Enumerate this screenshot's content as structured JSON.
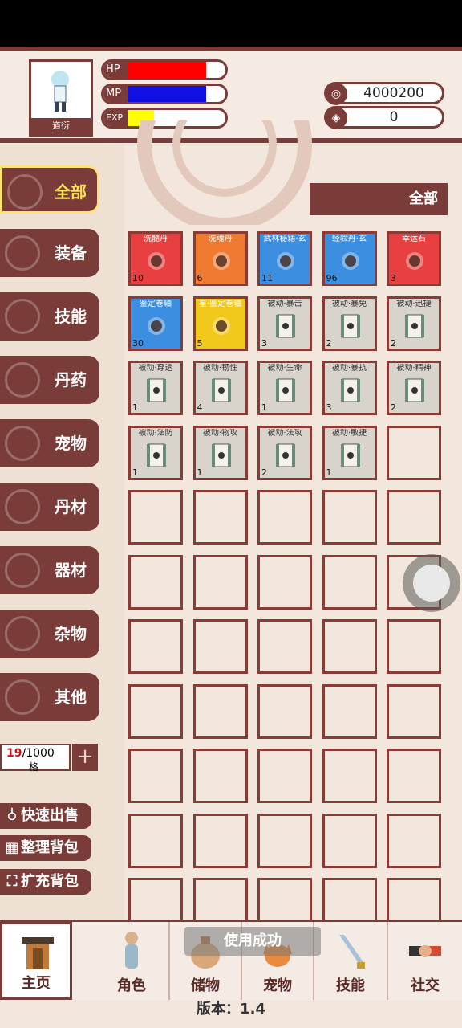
{
  "player": {
    "name": "道衍",
    "hp_label": "HP",
    "mp_label": "MP",
    "exp_label": "EXP",
    "hp_fill": 0.8,
    "mp_fill": 0.8,
    "exp_fill": 0.27,
    "gold": "4000200",
    "gems": "0"
  },
  "colors": {
    "brand": "#7a3c38",
    "hp": "#ff0000",
    "mp": "#1010e0",
    "exp": "#ffff00",
    "active": "#ffe15a"
  },
  "categories": [
    {
      "label": "全部",
      "active": true
    },
    {
      "label": "装备"
    },
    {
      "label": "技能"
    },
    {
      "label": "丹药"
    },
    {
      "label": "宠物"
    },
    {
      "label": "丹材"
    },
    {
      "label": "器材"
    },
    {
      "label": "杂物"
    },
    {
      "label": "其他"
    }
  ],
  "capacity": {
    "used": "19",
    "total": "/1000",
    "unit": "格"
  },
  "actions": {
    "quick_sell": "快速出售",
    "sort_bag": "整理背包",
    "expand_bag": "扩充背包"
  },
  "filter_tab": "全部",
  "items": [
    {
      "name": "洗髓丹",
      "count": "10",
      "bg": "#e84040",
      "icon": "red-orb-icon"
    },
    {
      "name": "洗魂丹",
      "count": "6",
      "bg": "#f07a30",
      "icon": "fire-orb-icon"
    },
    {
      "name": "武林秘籍·玄",
      "count": "11",
      "bg": "#3c8fe0",
      "icon": "scroll-book-icon"
    },
    {
      "name": "经验丹·玄",
      "count": "96",
      "bg": "#3c8fe0",
      "icon": "blue-pill-icon"
    },
    {
      "name": "幸运石",
      "count": "3",
      "bg": "#e84040",
      "icon": "green-gem-icon"
    },
    {
      "name": "鉴定卷轴",
      "count": "30",
      "bg": "#3c8fe0",
      "icon": "identify-scroll-icon"
    },
    {
      "name": "星·鉴定卷轴",
      "count": "5",
      "bg": "#f2c81c",
      "icon": "star-scroll-icon"
    },
    {
      "name": "被动·暴击",
      "count": "3",
      "bg": "#d8d4cc",
      "icon": "passive-scroll-icon"
    },
    {
      "name": "被动·暴免",
      "count": "2",
      "bg": "#d8d4cc",
      "icon": "passive-scroll-icon"
    },
    {
      "name": "被动·迅捷",
      "count": "2",
      "bg": "#d8d4cc",
      "icon": "passive-scroll-icon"
    },
    {
      "name": "被动·穿透",
      "count": "1",
      "bg": "#d8d4cc",
      "icon": "passive-scroll-icon"
    },
    {
      "name": "被动·韧性",
      "count": "4",
      "bg": "#d8d4cc",
      "icon": "passive-scroll-icon"
    },
    {
      "name": "被动·生命",
      "count": "1",
      "bg": "#d8d4cc",
      "icon": "passive-scroll-icon"
    },
    {
      "name": "被动·暴抗",
      "count": "3",
      "bg": "#d8d4cc",
      "icon": "passive-scroll-icon"
    },
    {
      "name": "被动·精神",
      "count": "2",
      "bg": "#d8d4cc",
      "icon": "passive-scroll-icon"
    },
    {
      "name": "被动·法防",
      "count": "1",
      "bg": "#d8d4cc",
      "icon": "passive-scroll-icon"
    },
    {
      "name": "被动·物攻",
      "count": "1",
      "bg": "#d8d4cc",
      "icon": "passive-scroll-icon"
    },
    {
      "name": "被动·法攻",
      "count": "2",
      "bg": "#d8d4cc",
      "icon": "passive-scroll-icon"
    },
    {
      "name": "被动·敏捷",
      "count": "1",
      "bg": "#d8d4cc",
      "icon": "passive-scroll-icon"
    }
  ],
  "nav": {
    "home": "主页",
    "role": "角色",
    "storage": "储物",
    "pet": "宠物",
    "skill": "技能",
    "social": "社交"
  },
  "toast": "使用成功",
  "version": "版本：1.4"
}
